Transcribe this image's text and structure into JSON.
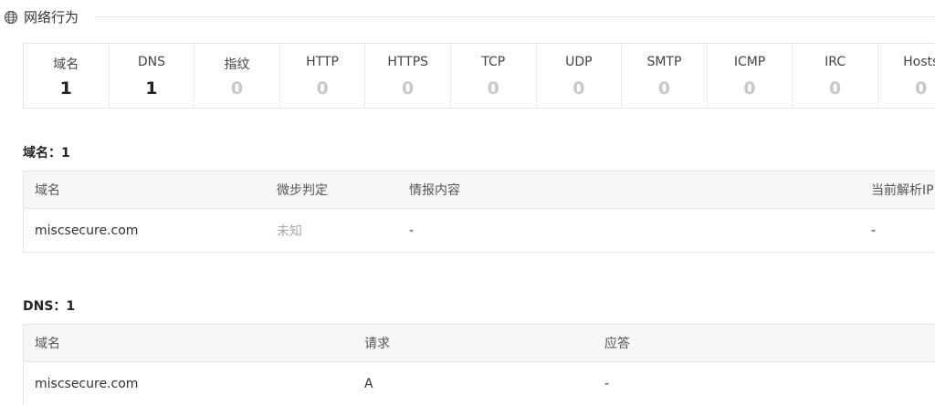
{
  "section": {
    "title": "网络行为",
    "icon": "globe-icon"
  },
  "stats": [
    {
      "label": "域名",
      "value": "1"
    },
    {
      "label": "DNS",
      "value": "1"
    },
    {
      "label": "指纹",
      "value": "0"
    },
    {
      "label": "HTTP",
      "value": "0"
    },
    {
      "label": "HTTPS",
      "value": "0"
    },
    {
      "label": "TCP",
      "value": "0"
    },
    {
      "label": "UDP",
      "value": "0"
    },
    {
      "label": "SMTP",
      "value": "0"
    },
    {
      "label": "ICMP",
      "value": "0"
    },
    {
      "label": "IRC",
      "value": "0"
    },
    {
      "label": "Hosts",
      "value": "0"
    }
  ],
  "domain_section": {
    "title": "域名：1",
    "columns": [
      "域名",
      "微步判定",
      "情报内容",
      "当前解析IP"
    ],
    "rows": [
      [
        "miscsecure.com",
        "未知",
        "-",
        "-"
      ]
    ]
  },
  "dns_section": {
    "title": "DNS：1",
    "columns": [
      "域名",
      "请求",
      "应答"
    ],
    "rows": [
      [
        "miscsecure.com",
        "A",
        "-"
      ]
    ]
  }
}
